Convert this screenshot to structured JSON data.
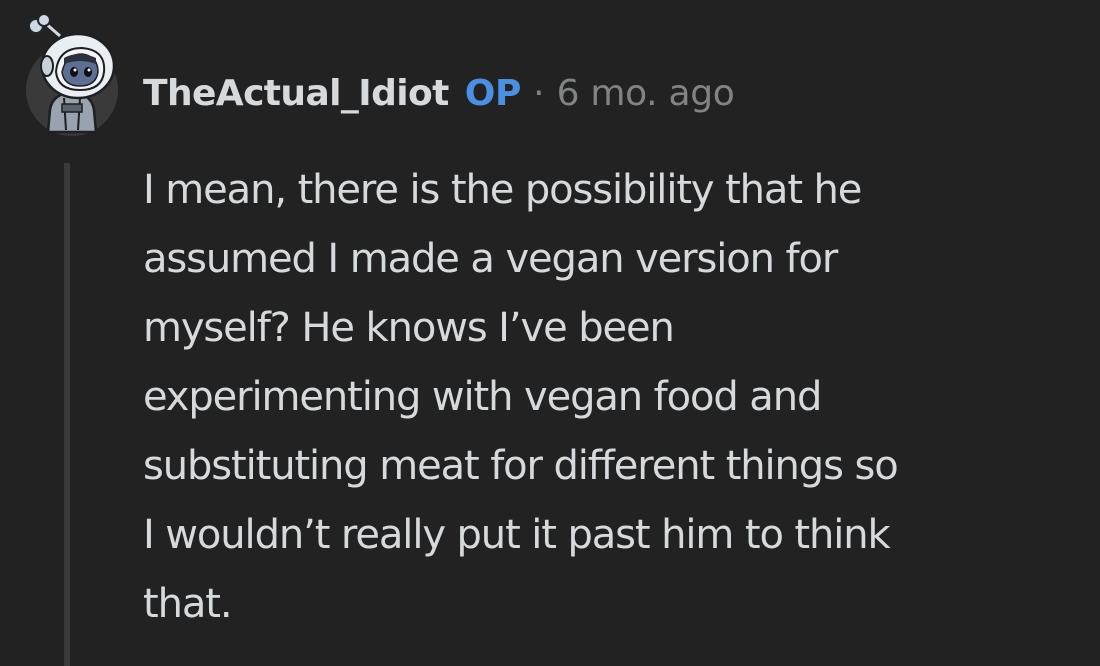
{
  "comment": {
    "author": "TheActual_Idiot",
    "op_badge": "OP",
    "separator": "·",
    "timestamp": "6 mo. ago",
    "avatar_icon": "snoo-astronaut-avatar-icon",
    "body_lines": [
      "I mean, there is the possibility that he",
      "assumed I made a vegan version for",
      "myself? He knows I’ve been",
      "experimenting with vegan food and",
      "substituting meat for different things so",
      "I wouldn’t really put it past him to think",
      "that."
    ]
  },
  "colors": {
    "background": "#222222",
    "text": "#d7dadc",
    "op_badge": "#4a90e2",
    "meta": "#818384",
    "thread_line": "#3a3a3b"
  }
}
